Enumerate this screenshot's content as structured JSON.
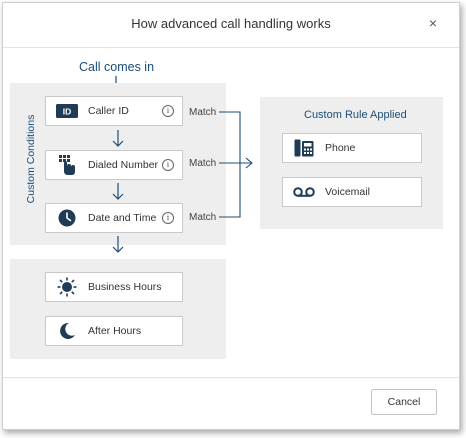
{
  "dialog": {
    "title": "How advanced call handling works",
    "close_label": "×",
    "cancel_label": "Cancel"
  },
  "flow": {
    "start_label": "Call comes in",
    "conditions_label": "Custom Conditions",
    "conditions": [
      {
        "label": "Caller ID",
        "icon": "id-card-icon",
        "match": "Match"
      },
      {
        "label": "Dialed Number",
        "icon": "dialpad-hand-icon",
        "match": "Match"
      },
      {
        "label": "Date and Time",
        "icon": "clock-icon",
        "match": "Match"
      }
    ],
    "hours": [
      {
        "label": "Business Hours",
        "icon": "sun-icon"
      },
      {
        "label": "After Hours",
        "icon": "moon-icon"
      }
    ]
  },
  "rule": {
    "title": "Custom Rule Applied",
    "targets": [
      {
        "label": "Phone",
        "icon": "desk-phone-icon"
      },
      {
        "label": "Voicemail",
        "icon": "voicemail-icon"
      }
    ]
  },
  "colors": {
    "accent": "#1b4e7a",
    "icon_dark": "#1f3b55",
    "panel": "#eeeeee"
  }
}
